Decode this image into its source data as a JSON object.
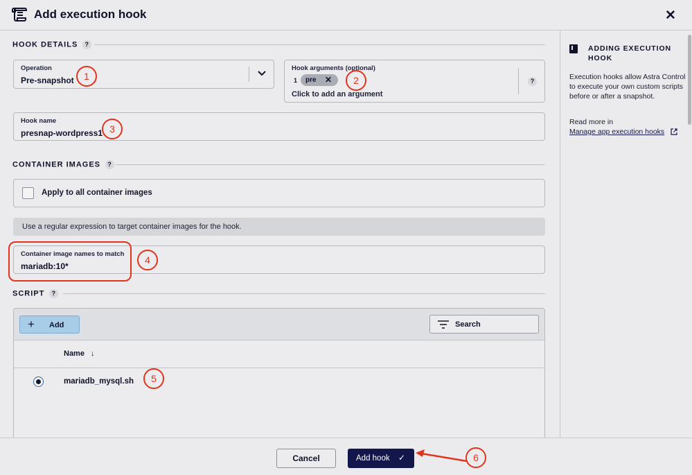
{
  "dialog": {
    "title": "Add execution hook",
    "close_symbol": "✕"
  },
  "hook_details": {
    "section_title": "HOOK DETAILS",
    "help": "?",
    "operation": {
      "label": "Operation",
      "value": "Pre-snapshot"
    },
    "hook_arguments": {
      "label": "Hook arguments (optional)",
      "line_number": "1",
      "chips": [
        "pre"
      ],
      "add_hint": "Click to add an argument"
    },
    "hook_name": {
      "label": "Hook name",
      "value": "presnap-wordpress1"
    }
  },
  "container_images": {
    "section_title": "CONTAINER IMAGES",
    "help": "?",
    "apply_all_label": "Apply to all container images",
    "apply_all_checked": false,
    "info_text": "Use a regular expression to target container images for the hook.",
    "match": {
      "label": "Container image names to match",
      "value": "mariadb:10*"
    }
  },
  "script": {
    "section_title": "SCRIPT",
    "help": "?",
    "add_label": "Add",
    "search_label": "Search",
    "column_name": "Name",
    "sort_arrow": "↓",
    "rows": [
      {
        "name": "mariadb_mysql.sh",
        "selected": true
      }
    ]
  },
  "footer": {
    "cancel_label": "Cancel",
    "add_hook_label": "Add hook"
  },
  "sidebar": {
    "title": "ADDING EXECUTION HOOK",
    "description": "Execution hooks allow Astra Control to execute your own custom scripts before or after a snapshot.",
    "read_more": "Read more in",
    "link_text": "Manage app execution hooks"
  },
  "annotations": [
    "1",
    "2",
    "3",
    "4",
    "5",
    "6"
  ],
  "colors": {
    "annotation_red": "#e2331c",
    "primary_button": "#13164a",
    "add_button": "#a8cde8",
    "background": "#ebebed"
  }
}
